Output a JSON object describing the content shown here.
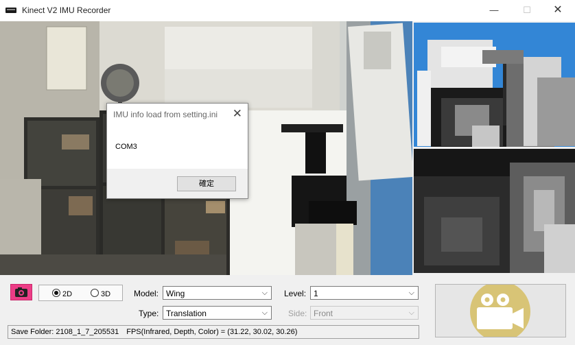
{
  "window": {
    "title": "Kinect V2 IMU Recorder",
    "controls": {
      "minimize": "—",
      "maximize": "☐",
      "close": "✕"
    }
  },
  "views": {
    "color_view": "color-camera-feed",
    "depth_view": "depth-camera-feed",
    "infrared_view": "infrared-camera-feed"
  },
  "controls": {
    "snapshot_icon": "camera-icon",
    "mode": {
      "options": [
        "2D",
        "3D"
      ],
      "selected": "2D"
    },
    "model": {
      "label": "Model:",
      "value": "Wing",
      "chevron": "⌵"
    },
    "type": {
      "label": "Type:",
      "value": "Translation",
      "chevron": "⌵"
    },
    "level": {
      "label": "Level:",
      "value": "1",
      "chevron": "⌵"
    },
    "side": {
      "label": "Side:",
      "value": "Front",
      "chevron": "⌵",
      "enabled": false
    },
    "record_icon": "video-camera-icon"
  },
  "status": {
    "save_folder": "Save Folder: 2108_1_7_205531",
    "fps": "FPS(Infrared, Depth, Color) = (31.22,  30.02,  30.26)"
  },
  "dialog": {
    "title": "IMU info load from setting.ini",
    "message": "COM3",
    "ok_label": "確定",
    "close": "✕"
  },
  "colors": {
    "snapshot_button": "#ec3d86",
    "record_icon_circle": "#d8c476",
    "depth_background": "#3386d6"
  }
}
